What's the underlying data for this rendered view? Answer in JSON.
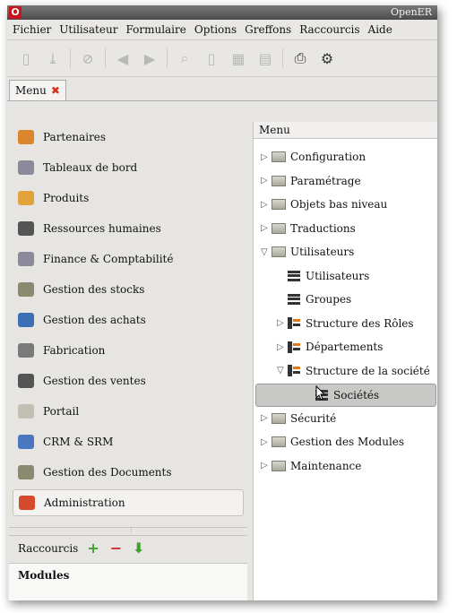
{
  "window": {
    "title": "OpenER"
  },
  "menubar": [
    "Fichier",
    "Utilisateur",
    "Formulaire",
    "Options",
    "Greffons",
    "Raccourcis",
    "Aide"
  ],
  "tab": {
    "label": "Menu"
  },
  "left_menu": [
    {
      "label": "Partenaires",
      "icon": "partners-icon",
      "color": "#d9862c"
    },
    {
      "label": "Tableaux de bord",
      "icon": "dashboard-icon",
      "color": "#8a8a9a"
    },
    {
      "label": "Produits",
      "icon": "products-icon",
      "color": "#e2a43a"
    },
    {
      "label": "Ressources humaines",
      "icon": "hr-icon",
      "color": "#555555"
    },
    {
      "label": "Finance & Comptabilité",
      "icon": "finance-icon",
      "color": "#8a8a9a"
    },
    {
      "label": "Gestion des stocks",
      "icon": "stock-icon",
      "color": "#8a8a70"
    },
    {
      "label": "Gestion des achats",
      "icon": "purchase-icon",
      "color": "#3d6fb5"
    },
    {
      "label": "Fabrication",
      "icon": "manufacturing-icon",
      "color": "#7a7a7a"
    },
    {
      "label": "Gestion des ventes",
      "icon": "sales-icon",
      "color": "#555555"
    },
    {
      "label": "Portail",
      "icon": "portal-icon",
      "color": "#c0c0b4"
    },
    {
      "label": "CRM & SRM",
      "icon": "crm-icon",
      "color": "#4a78c0"
    },
    {
      "label": "Gestion des Documents",
      "icon": "documents-icon",
      "color": "#8a8a70"
    },
    {
      "label": "Administration",
      "icon": "administration-icon",
      "color": "#d44a2a"
    }
  ],
  "shortcuts": {
    "label": "Raccourcis",
    "add": "+",
    "remove": "−",
    "install": "⬇"
  },
  "modules": {
    "label": "Modules"
  },
  "tree": {
    "header": "Menu",
    "items": [
      {
        "label": "Configuration",
        "level": 0,
        "expander": "▷",
        "icon": "folder"
      },
      {
        "label": "Paramétrage",
        "level": 0,
        "expander": "▷",
        "icon": "folder"
      },
      {
        "label": "Objets bas niveau",
        "level": 0,
        "expander": "▷",
        "icon": "folder"
      },
      {
        "label": "Traductions",
        "level": 0,
        "expander": "▷",
        "icon": "folder"
      },
      {
        "label": "Utilisateurs",
        "level": 0,
        "expander": "▽",
        "icon": "folder"
      },
      {
        "label": "Utilisateurs",
        "level": 1,
        "expander": "",
        "icon": "list"
      },
      {
        "label": "Groupes",
        "level": 1,
        "expander": "",
        "icon": "list"
      },
      {
        "label": "Structure des Rôles",
        "level": 1,
        "expander": "▷",
        "icon": "struct"
      },
      {
        "label": "Départements",
        "level": 1,
        "expander": "▷",
        "icon": "struct"
      },
      {
        "label": "Structure de la société",
        "level": 1,
        "expander": "▽",
        "icon": "struct"
      },
      {
        "label": "Sociétés",
        "level": 2,
        "expander": "",
        "icon": "list",
        "selected": true
      },
      {
        "label": "Sécurité",
        "level": 0,
        "expander": "▷",
        "icon": "folder"
      },
      {
        "label": "Gestion des Modules",
        "level": 0,
        "expander": "▷",
        "icon": "folder"
      },
      {
        "label": "Maintenance",
        "level": 0,
        "expander": "▷",
        "icon": "folder"
      }
    ]
  }
}
